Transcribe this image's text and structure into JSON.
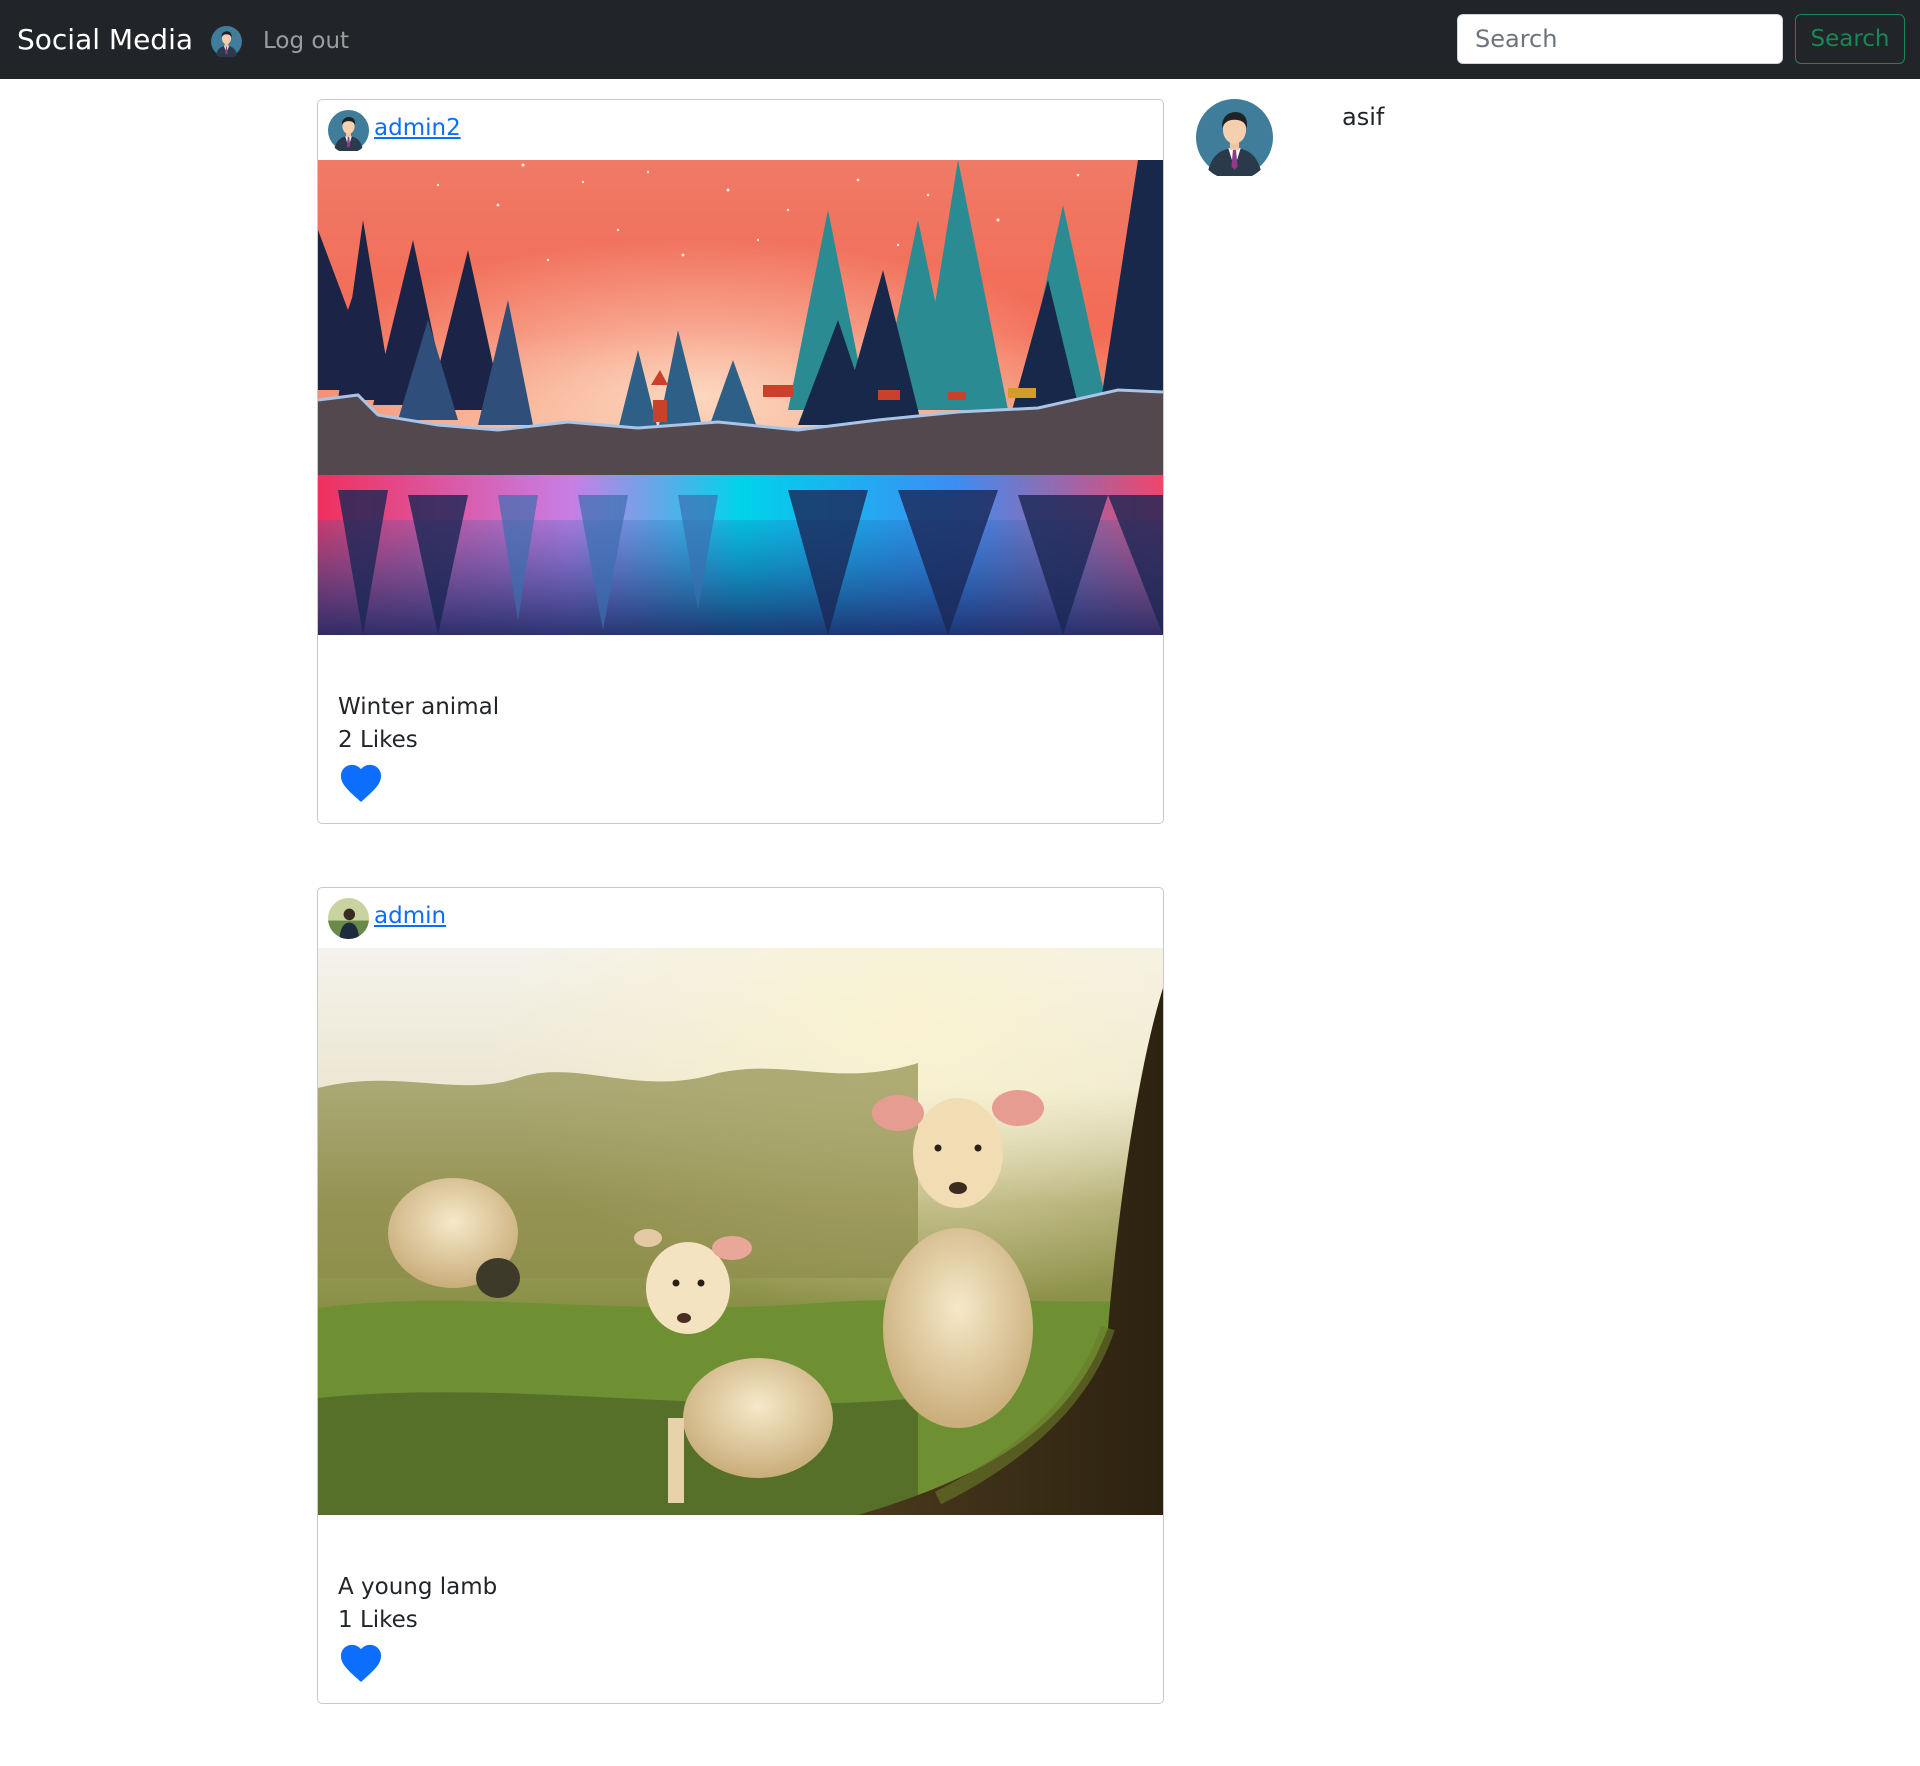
{
  "navbar": {
    "brand": "Social Media",
    "avatar_icon": "user-avatar-icon",
    "logout_label": "Log out",
    "search_placeholder": "Search",
    "search_button_label": "Search"
  },
  "colors": {
    "navbar_bg": "#212529",
    "link": "#0d6efd",
    "heart": "#0d6efd",
    "search_button": "#198754"
  },
  "posts": [
    {
      "author": "admin2",
      "caption": "Winter animal",
      "likes": "2 Likes",
      "image": "winter-forest-deer-illustration",
      "heart_icon": "heart-icon"
    },
    {
      "author": "admin",
      "caption": "A young lamb",
      "likes": "1 Likes",
      "image": "lambs-in-meadow-photo",
      "heart_icon": "heart-icon"
    }
  ],
  "sidebar": {
    "username": "asif",
    "avatar_icon": "profile-avatar-icon"
  }
}
